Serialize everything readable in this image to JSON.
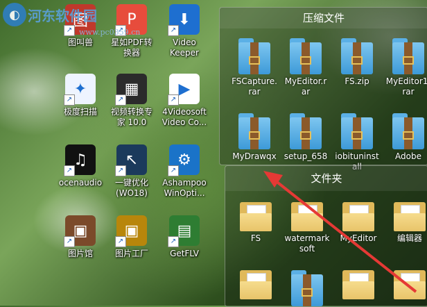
{
  "watermark": {
    "text": "河东软件园",
    "sub": "www.pc0359.cn"
  },
  "desktop_icons": [
    {
      "label": "图叫兽",
      "color": "#c0392b",
      "glyph": "图"
    },
    {
      "label": "星如PDF转\n换器",
      "color": "#e74c3c",
      "glyph": "P"
    },
    {
      "label": "Video\nKeeper",
      "color": "#1e6fd0",
      "glyph": "⬇"
    },
    {
      "label": "极度扫描",
      "color": "#eef4ff",
      "glyph": "✦"
    },
    {
      "label": "视频转换专\n家 10.0",
      "color": "#2b2b2b",
      "glyph": "▦"
    },
    {
      "label": "4Videosoft\nVideo Co...",
      "color": "#ffffff",
      "glyph": "▶"
    },
    {
      "label": "ocenaudio",
      "color": "#111111",
      "glyph": "♫"
    },
    {
      "label": "一键优化\n(WO18)",
      "color": "#1b3a5c",
      "glyph": "↖"
    },
    {
      "label": "Ashampoo\nWinOpti...",
      "color": "#1a73c8",
      "glyph": "⚙"
    },
    {
      "label": "图片馆",
      "color": "#7b4a2a",
      "glyph": "▣"
    },
    {
      "label": "图片工厂",
      "color": "#b8860b",
      "glyph": "▣"
    },
    {
      "label": "GetFLV",
      "color": "#2e7d32",
      "glyph": "▤"
    }
  ],
  "archive_fence": {
    "title": "压缩文件",
    "items": [
      {
        "label": "FSCapture.\nrar"
      },
      {
        "label": "MyEditor.r\nar"
      },
      {
        "label": "FS.zip"
      },
      {
        "label": "MyEditor1.\nrar"
      },
      {
        "label": "MyDrawqx"
      },
      {
        "label": "setup_658"
      },
      {
        "label": "iobituninst\nall"
      },
      {
        "label": "Adobe"
      }
    ]
  },
  "folder_fence": {
    "title": "文件夹",
    "items": [
      {
        "label": "FS"
      },
      {
        "label": "watermark\nsoft"
      },
      {
        "label": "MyEditor"
      },
      {
        "label": "编辑器"
      }
    ]
  },
  "colors": {
    "annotation_arrow": "#e53935"
  }
}
